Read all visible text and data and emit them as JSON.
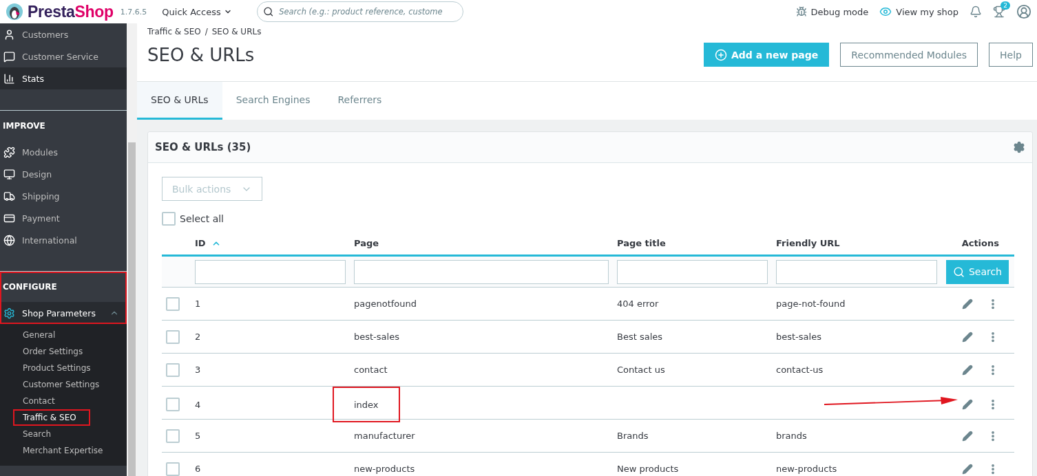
{
  "header": {
    "logo": {
      "first": "Presta",
      "second": "Shop"
    },
    "version": "1.7.6.5",
    "quick_access": "Quick Access",
    "search": {
      "placeholder": "Search (e.g.: product reference, custome"
    },
    "debug": "Debug mode",
    "view_shop": "View my shop",
    "notifications_badge": "2"
  },
  "sidebar": {
    "top_items": [
      {
        "label": "Customers",
        "selected": false
      },
      {
        "label": "Customer Service",
        "selected": false
      },
      {
        "label": "Stats",
        "selected": true
      }
    ],
    "sections": [
      {
        "title": "IMPROVE",
        "highlighted": false,
        "items": [
          {
            "label": "Modules",
            "expanded": false
          },
          {
            "label": "Design",
            "expanded": false
          },
          {
            "label": "Shipping",
            "expanded": false
          },
          {
            "label": "Payment",
            "expanded": false
          },
          {
            "label": "International",
            "expanded": false
          }
        ]
      },
      {
        "title": "CONFIGURE",
        "highlighted": true,
        "items": [
          {
            "label": "Shop Parameters",
            "expanded": true,
            "children": [
              {
                "label": "General",
                "selected": false,
                "highlighted": false
              },
              {
                "label": "Order Settings",
                "selected": false,
                "highlighted": false
              },
              {
                "label": "Product Settings",
                "selected": false,
                "highlighted": false
              },
              {
                "label": "Customer Settings",
                "selected": false,
                "highlighted": false
              },
              {
                "label": "Contact",
                "selected": false,
                "highlighted": false
              },
              {
                "label": "Traffic & SEO",
                "selected": true,
                "highlighted": true
              },
              {
                "label": "Search",
                "selected": false,
                "highlighted": false
              },
              {
                "label": "Merchant Expertise",
                "selected": false,
                "highlighted": false
              }
            ]
          }
        ]
      }
    ]
  },
  "breadcrumb": {
    "items": [
      "Traffic & SEO",
      "SEO & URLs"
    ],
    "separator": "/"
  },
  "title": "SEO & URLs",
  "actions": [
    {
      "label": "Add a new page",
      "kind": "primary"
    },
    {
      "label": "Recommended Modules",
      "kind": "outline"
    },
    {
      "label": "Help",
      "kind": "outline"
    }
  ],
  "tabs": [
    {
      "label": "SEO & URLs",
      "selected": true
    },
    {
      "label": "Search Engines",
      "selected": false
    },
    {
      "label": "Referrers",
      "selected": false
    }
  ],
  "card": {
    "title": "SEO & URLs (35)",
    "bulk_actions": "Bulk actions",
    "select_all": {
      "label": "Select all",
      "checked": false
    },
    "search_button": "Search",
    "columns": [
      {
        "label": "ID",
        "sorted": true
      },
      {
        "label": "Page",
        "sorted": false
      },
      {
        "label": "Page title",
        "sorted": false
      },
      {
        "label": "Friendly URL",
        "sorted": false
      },
      {
        "label": "Actions",
        "sorted": false
      }
    ],
    "rows": [
      {
        "id": "1",
        "page": "pagenotfound",
        "page_title": "404 error",
        "friendly_url": "page-not-found",
        "checked": false,
        "highlighted": false,
        "arrow": false
      },
      {
        "id": "2",
        "page": "best-sales",
        "page_title": "Best sales",
        "friendly_url": "best-sales",
        "checked": false,
        "highlighted": false,
        "arrow": false
      },
      {
        "id": "3",
        "page": "contact",
        "page_title": "Contact us",
        "friendly_url": "contact-us",
        "checked": false,
        "highlighted": false,
        "arrow": false
      },
      {
        "id": "4",
        "page": "index",
        "page_title": "",
        "friendly_url": "",
        "checked": false,
        "highlighted": true,
        "arrow": true
      },
      {
        "id": "5",
        "page": "manufacturer",
        "page_title": "Brands",
        "friendly_url": "brands",
        "checked": false,
        "highlighted": false,
        "arrow": false
      },
      {
        "id": "6",
        "page": "new-products",
        "page_title": "New products",
        "friendly_url": "new-products",
        "checked": false,
        "highlighted": false,
        "arrow": false
      }
    ]
  }
}
